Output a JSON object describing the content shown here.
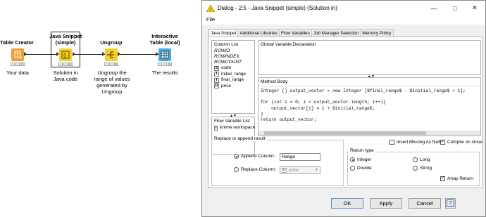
{
  "workflow": {
    "nodes": [
      {
        "title": "Table Creator",
        "desc": "Your data",
        "color": "#f39c33"
      },
      {
        "title": "Java Snippet\n(simple)",
        "desc": "Solution in\nJava code",
        "color": "#f2cf2b"
      },
      {
        "title": "Ungroup",
        "desc": "Ungroup the\nrange of values\ngenerated by\nUngroup",
        "color": "#f2cf2b"
      },
      {
        "title": "Interactive\nTable (local)",
        "desc": "The results",
        "color": "#49a7d9"
      }
    ]
  },
  "dialog": {
    "title": "Dialog - 2:5 - Java Snippet (simple) (Solution in)",
    "menu": "File",
    "tabs": [
      "Java Snippet",
      "Additional Libraries",
      "Flow Variables",
      "Job Manager Selection",
      "Memory Policy"
    ],
    "column_list": {
      "header": "Column List",
      "special": [
        "ROWID",
        "ROWINDEX",
        "ROWCOUNT"
      ],
      "columns": [
        {
          "type": "S",
          "name": "code"
        },
        {
          "type": "I",
          "name": "initial_range"
        },
        {
          "type": "I",
          "name": "final_range"
        },
        {
          "type": "D",
          "name": "price"
        }
      ]
    },
    "flow_variables": {
      "header": "Flow Variable List",
      "items": [
        {
          "type": "s",
          "name": "knime.workspace"
        }
      ]
    },
    "global_header": "Global Variable Declaration",
    "method_header": "Method Body",
    "code": "Integer [] output_vector = new Integer [$final_range$ - $initial_range$ + 1];\n\nfor (int i = 0; i < output_vector.length; i++){\n    output_vector[i] = i + $initial_range$;\n}\nreturn output_vector;",
    "replace_group": {
      "label": "Replace or append result",
      "append_label": "Append Column:",
      "append_value": "Range",
      "replace_label": "Replace Column:",
      "replace_type": "D",
      "replace_value": "price"
    },
    "insert_missing": "Insert Missing As Null",
    "compile_on_close": "Compile on close",
    "return_type": {
      "label": "Return type",
      "options": [
        "Integer",
        "Long",
        "Double",
        "String"
      ],
      "selected": "Integer",
      "array_return": "Array Return"
    },
    "buttons": {
      "ok": "OK",
      "apply": "Apply",
      "cancel": "Cancel",
      "help": "?"
    }
  }
}
